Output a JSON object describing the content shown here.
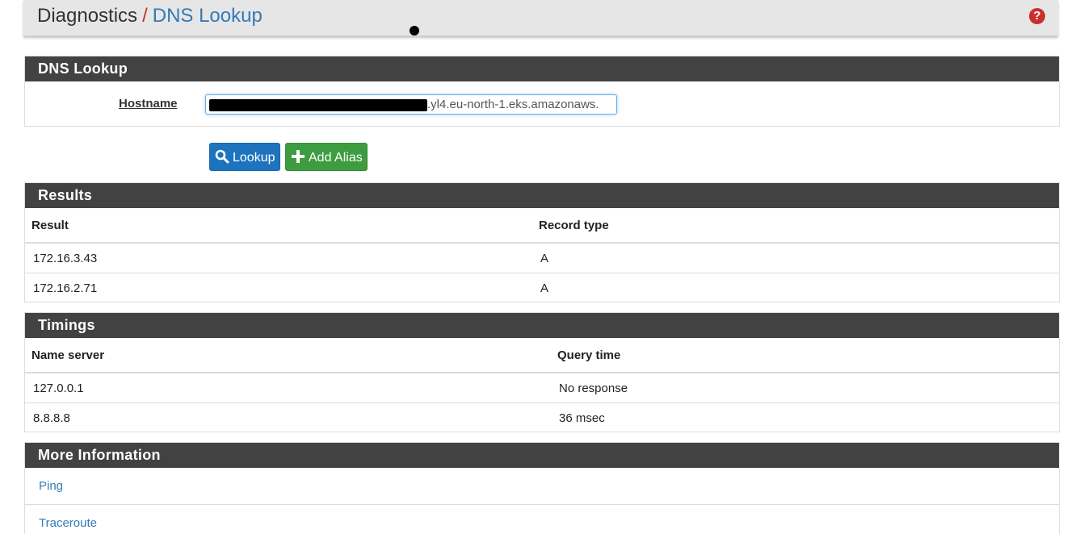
{
  "breadcrumb": {
    "parent": "Diagnostics",
    "separator": "/",
    "current": "DNS Lookup",
    "help_icon": "question-circle-icon",
    "help_color": "#c9302c"
  },
  "lookup_panel": {
    "title": "DNS Lookup",
    "hostname_label": "Hostname",
    "hostname_value": ".yl4.eu-north-1.eks.amazonaws."
  },
  "buttons": {
    "lookup_label": "Lookup",
    "lookup_icon": "search-icon",
    "lookup_color": "#1e73be",
    "add_alias_label": "Add Alias",
    "add_alias_icon": "plus-icon",
    "add_alias_color": "#3d9c3f"
  },
  "results": {
    "title": "Results",
    "columns": [
      "Result",
      "Record type"
    ],
    "rows": [
      [
        "172.16.3.43",
        "A"
      ],
      [
        "172.16.2.71",
        "A"
      ]
    ]
  },
  "timings": {
    "title": "Timings",
    "columns": [
      "Name server",
      "Query time"
    ],
    "rows": [
      [
        "127.0.0.1",
        "No response"
      ],
      [
        "8.8.8.8",
        "36 msec"
      ]
    ]
  },
  "more_info": {
    "title": "More Information",
    "links": [
      "Ping",
      "Traceroute"
    ]
  },
  "colors": {
    "panel_heading_bg": "#424242",
    "link_color": "#337ab7"
  }
}
